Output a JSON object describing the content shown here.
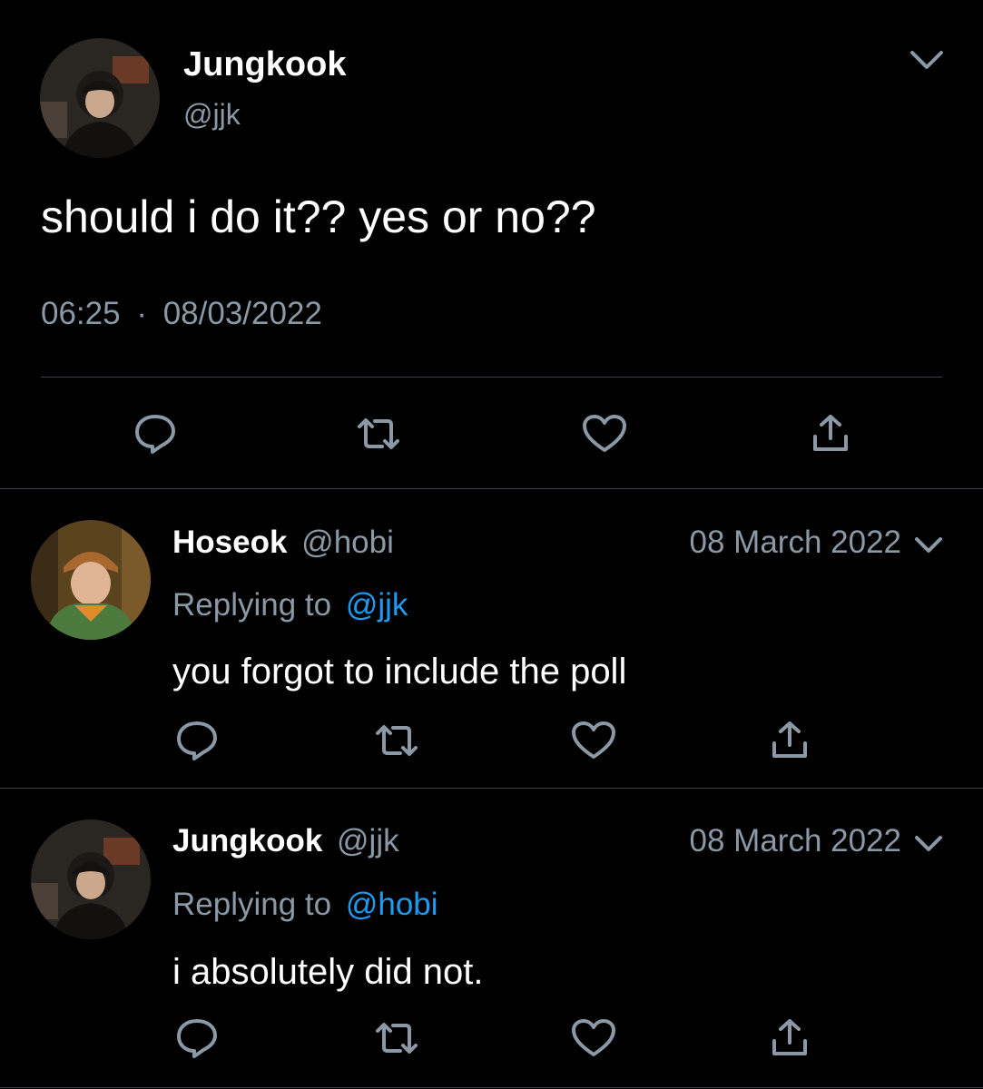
{
  "main_tweet": {
    "display_name": "Jungkook",
    "handle": "@jjk",
    "text": "should i do it?? yes or no??",
    "time": "06:25",
    "separator": "·",
    "date": "08/03/2022",
    "avatar_icon": "user-avatar-photo",
    "menu_icon": "chevron-down-icon"
  },
  "replies": [
    {
      "display_name": "Hoseok",
      "handle": "@hobi",
      "date": "08 March 2022",
      "replying_prefix": "Replying to",
      "replying_handle": "@jjk",
      "text": "you forgot to include the poll"
    },
    {
      "display_name": "Jungkook",
      "handle": "@jjk",
      "date": "08 March 2022",
      "replying_prefix": "Replying to",
      "replying_handle": "@hobi",
      "text": "i absolutely did not."
    }
  ],
  "actions": [
    "reply-icon",
    "retweet-icon",
    "like-icon",
    "share-icon"
  ],
  "colors": {
    "background": "#000000",
    "text": "#ffffff",
    "muted": "#8b98a5",
    "link": "#1d9bf0",
    "divider": "#38444d"
  }
}
